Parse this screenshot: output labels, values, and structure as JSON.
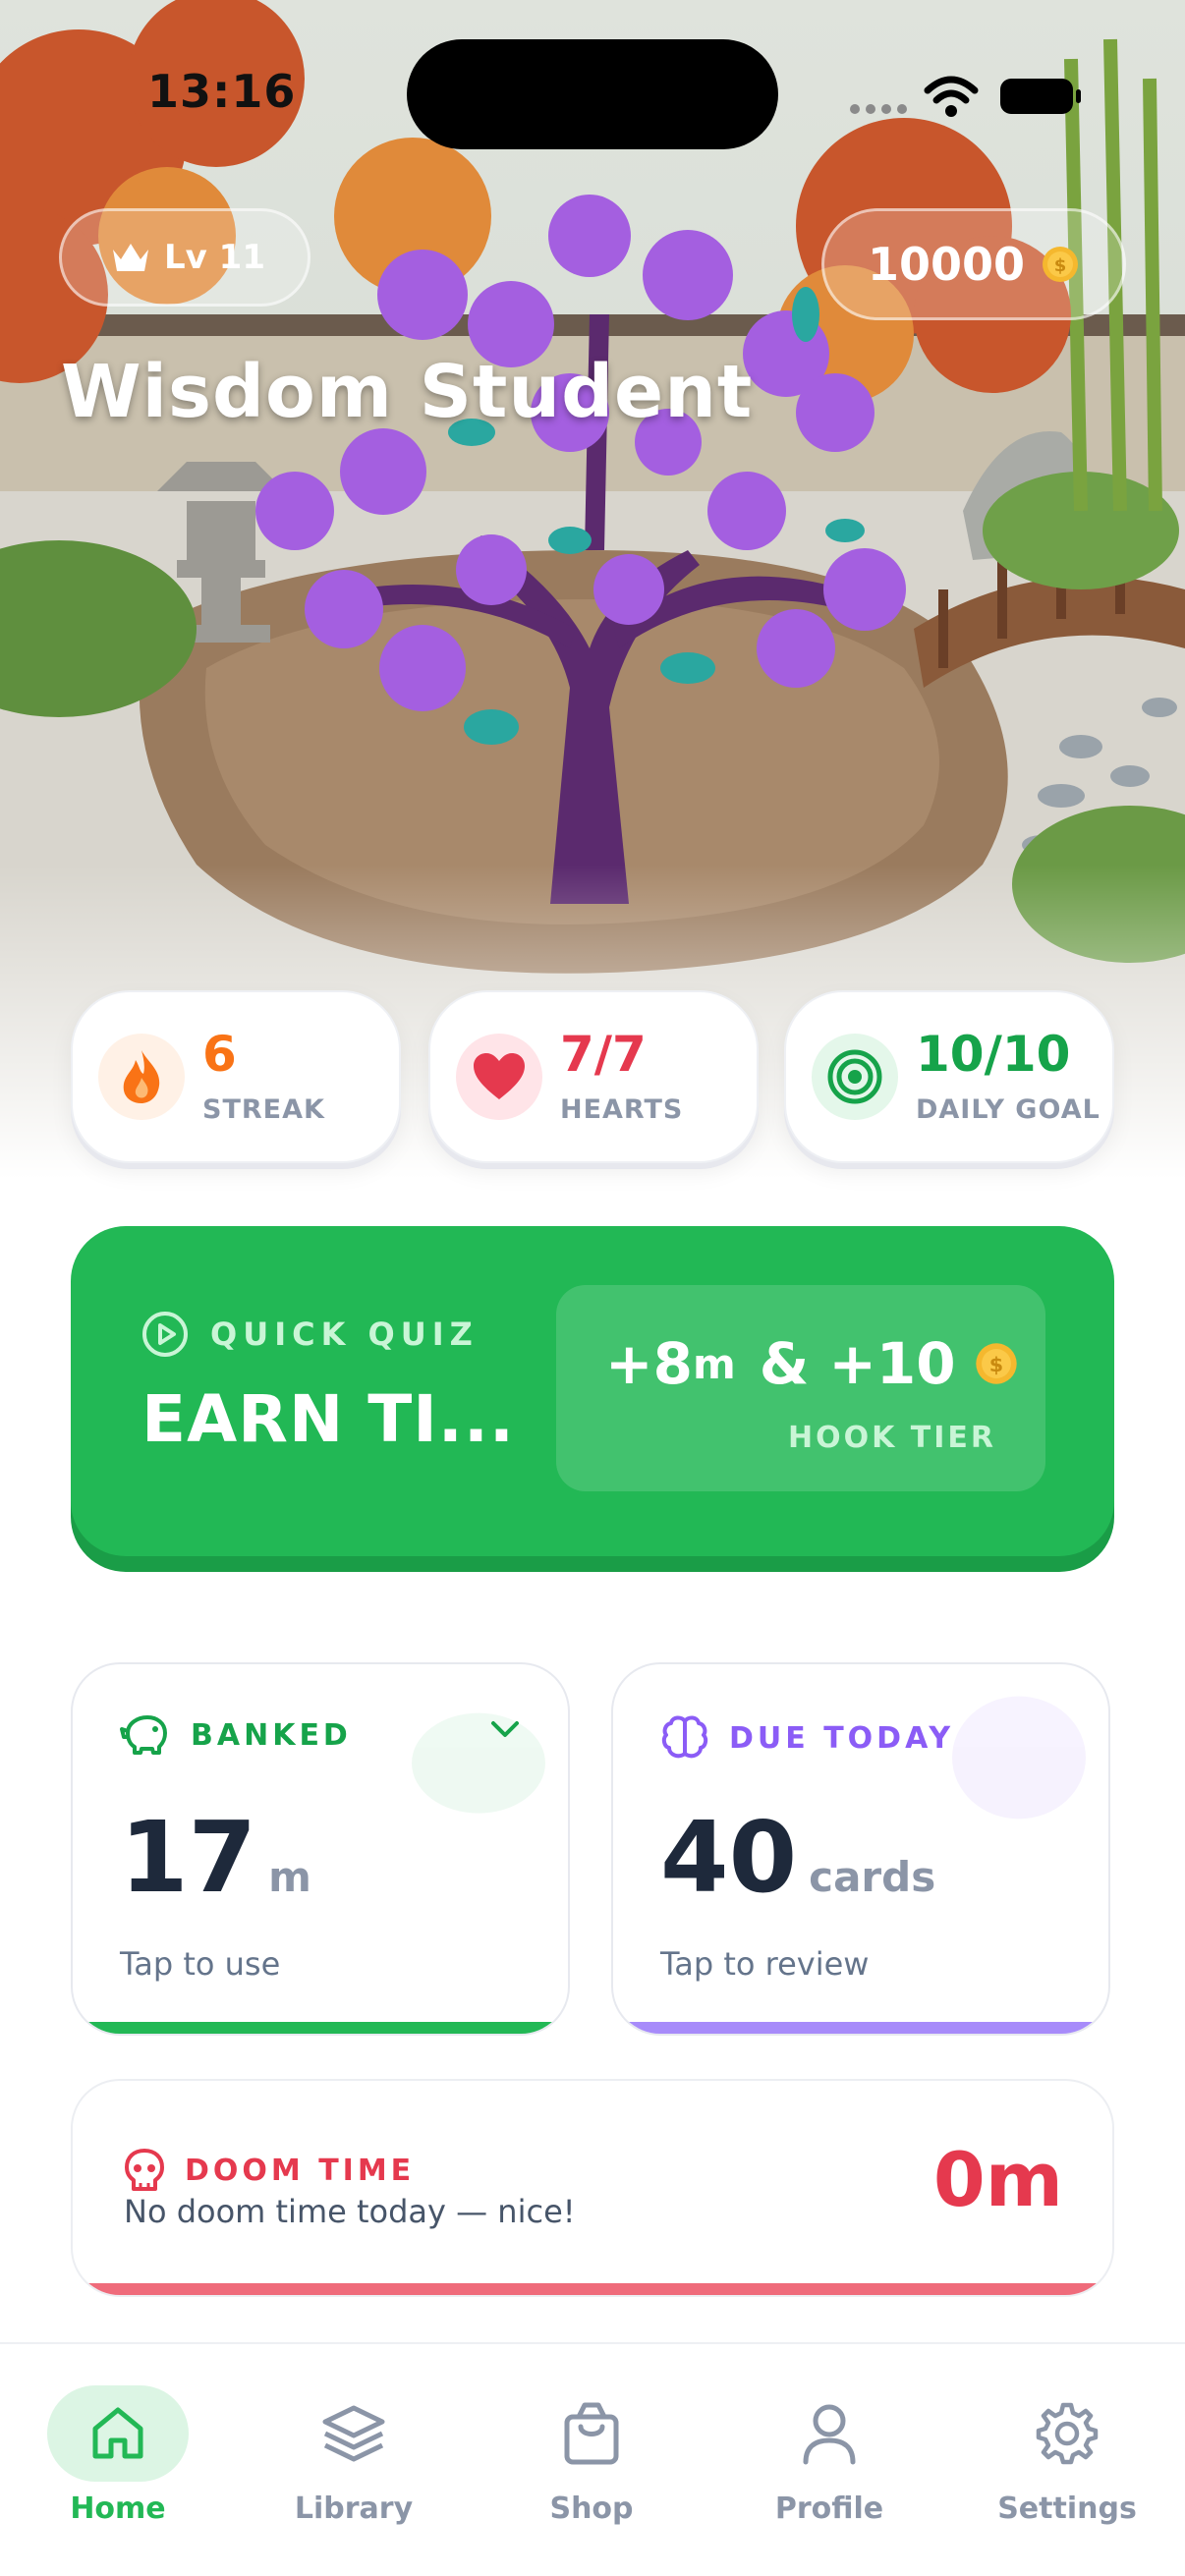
{
  "status_bar": {
    "time": "13:16"
  },
  "header": {
    "level": "Lv 11",
    "coins": "10000",
    "title": "Wisdom Student"
  },
  "stats": [
    {
      "value": "6",
      "label": "STREAK",
      "icon": "flame-icon",
      "color": "#f97316"
    },
    {
      "value": "7/7",
      "label": "HEARTS",
      "icon": "heart-icon",
      "color": "#e5394e"
    },
    {
      "value": "10/10",
      "label": "DAILY GOAL",
      "icon": "target-icon",
      "color": "#16a34a"
    }
  ],
  "quiz": {
    "label": "QUICK QUIZ",
    "title": "EARN TI...",
    "reward_minutes": "+8",
    "reward_unit": "m",
    "reward_join": "&",
    "reward_coins": "+10",
    "tier": "HOOK TIER"
  },
  "banked": {
    "label": "BANKED",
    "value": "17",
    "unit": "m",
    "hint": "Tap to use",
    "accent": "#22b855"
  },
  "due_today": {
    "label": "DUE TODAY",
    "value": "40",
    "unit": "cards",
    "hint": "Tap to review",
    "accent": "#a78bfa"
  },
  "doom": {
    "label": "DOOM TIME",
    "message": "No doom time today — nice!",
    "value": "0m",
    "accent": "#e5394e"
  },
  "tabs": [
    {
      "label": "Home",
      "icon": "home-icon",
      "active": true
    },
    {
      "label": "Library",
      "icon": "layers-icon"
    },
    {
      "label": "Shop",
      "icon": "shopping-bag-icon"
    },
    {
      "label": "Profile",
      "icon": "user-icon"
    },
    {
      "label": "Settings",
      "icon": "gear-icon"
    }
  ],
  "colors": {
    "brand_green": "#22b855",
    "purple": "#8b5cf6",
    "red": "#e5394e"
  }
}
